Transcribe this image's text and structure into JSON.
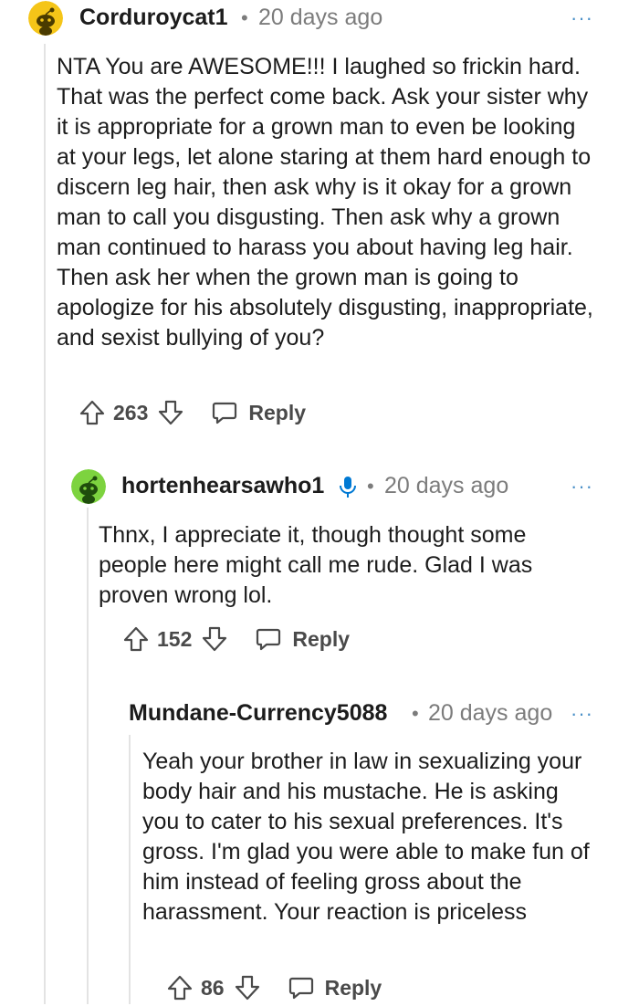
{
  "comments": [
    {
      "username": "Corduroycat1",
      "separator": "•",
      "time": "20 days ago",
      "more": "···",
      "avatar_color": "#f5c518",
      "text": "NTA You are AWESOME!!! I laughed so frickin hard. That was the perfect come back. Ask your sister why it is appropriate for a grown man to even be looking at your legs, let alone staring at them hard enough to discern leg hair, then ask why is it okay for a grown man to call you disgusting. Then ask why a grown man continued to harass you about having leg hair. Then ask her when the grown man is going to apologize for his absolutely disgusting, inappropriate, and sexist bullying of you?",
      "score": "263",
      "reply_label": "Reply"
    },
    {
      "username": "hortenhearsawho1",
      "op_icon": "microphone-icon",
      "separator": "•",
      "time": "20 days ago",
      "more": "···",
      "avatar_color": "#7dd33f",
      "text": "Thnx, I appreciate it, though thought some people here might call me rude. Glad I was proven wrong lol.",
      "score": "152",
      "reply_label": "Reply"
    },
    {
      "username": "Mundane-Currency5088",
      "separator": "•",
      "time": "20 days ago",
      "more": "···",
      "text": "Yeah your brother in law in sexualizing your body hair and his mustache. He is asking you to cater to his sexual preferences. It's gross. I'm glad you were able to make fun of him instead of feeling gross about the harassment. Your reaction is priceless",
      "score": "86",
      "reply_label": "Reply"
    }
  ],
  "colors": {
    "text": "#1c1c1c",
    "meta": "#7c7c7c",
    "action": "#4a4a4a",
    "accent": "#4a90c8",
    "thread_line": "#e3e3e3"
  }
}
